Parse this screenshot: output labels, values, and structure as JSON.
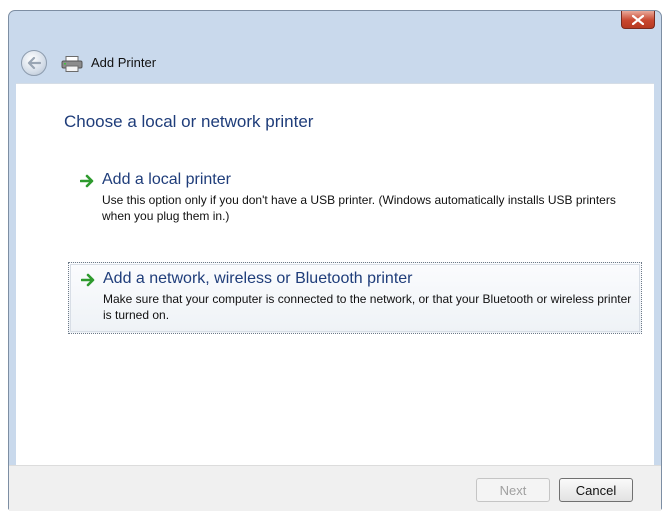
{
  "window": {
    "title": "Add Printer"
  },
  "content": {
    "heading": "Choose a local or network printer",
    "options": [
      {
        "title": "Add a local printer",
        "description": "Use this option only if you don't have a USB printer. (Windows automatically installs USB printers when you plug them in.)"
      },
      {
        "title": "Add a network, wireless or Bluetooth printer",
        "description": "Make sure that your computer is connected to the network, or that your Bluetooth or wireless printer is turned on."
      }
    ]
  },
  "footer": {
    "next_label": "Next",
    "cancel_label": "Cancel"
  },
  "icons": {
    "back": "back-arrow-icon",
    "printer": "printer-icon",
    "option_arrow": "green-arrow-icon",
    "close": "close-icon"
  },
  "colors": {
    "heading": "#1f3d7a",
    "arrow": "#2e9a2e",
    "close_button": "#c8472f",
    "frame": "#c9d9ec"
  }
}
